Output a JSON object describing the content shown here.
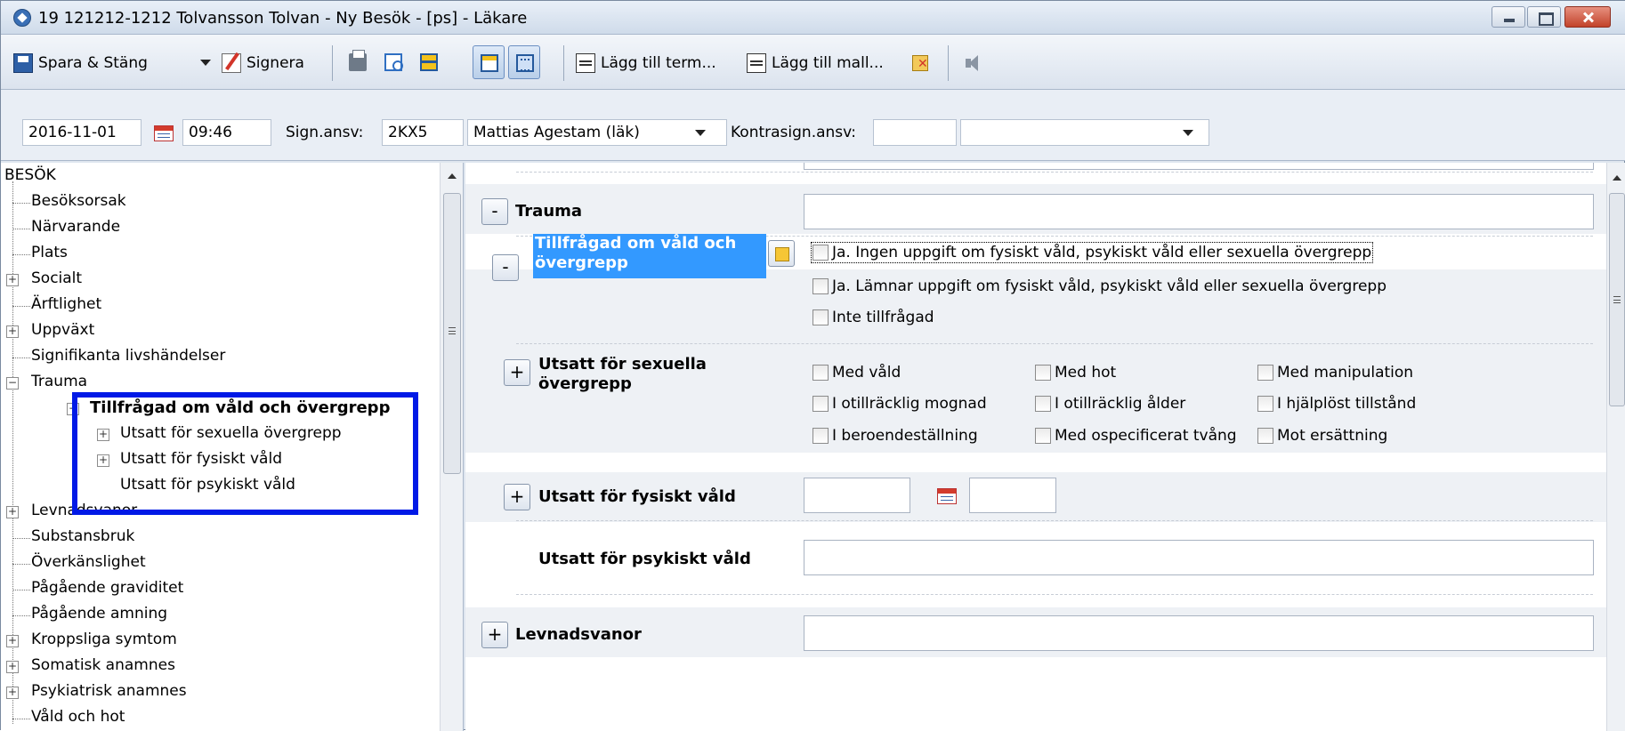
{
  "window": {
    "title": "19 121212-1212 Tolvansson Tolvan - Ny Besök - [ps] - Läkare"
  },
  "toolbar": {
    "save_close": "Spara & Stäng",
    "sign": "Signera",
    "add_term": "Lägg till term...",
    "add_template": "Lägg till mall..."
  },
  "header": {
    "date": "2016-11-01",
    "time": "09:46",
    "sign_resp_label": "Sign.ansv:",
    "sign_resp_code": "2KX5",
    "sign_resp_name": "Mattias Agestam (läk)",
    "countersign_label": "Kontrasign.ansv:",
    "countersign_code": "",
    "countersign_name": ""
  },
  "tree": {
    "root": "BESÖK",
    "items": [
      {
        "label": "Besöksorsak"
      },
      {
        "label": "Närvarande"
      },
      {
        "label": "Plats"
      },
      {
        "label": "Socialt"
      },
      {
        "label": "Ärftlighet"
      },
      {
        "label": "Uppväxt"
      },
      {
        "label": "Signifikanta livshändelser"
      },
      {
        "label": "Trauma"
      },
      {
        "label": "Tillfrågad om våld och övergrepp"
      },
      {
        "label": "Utsatt för sexuella övergrepp"
      },
      {
        "label": "Utsatt för fysiskt våld"
      },
      {
        "label": "Utsatt för psykiskt våld"
      },
      {
        "label": "Levnadsvanor"
      },
      {
        "label": "Substansbruk"
      },
      {
        "label": "Överkänslighet"
      },
      {
        "label": "Pågående graviditet"
      },
      {
        "label": "Pågående amning"
      },
      {
        "label": "Kroppsliga symtom"
      },
      {
        "label": "Somatisk anamnes"
      },
      {
        "label": "Psykiatrisk anamnes"
      },
      {
        "label": "Våld och hot"
      }
    ]
  },
  "form": {
    "trauma": {
      "label": "Trauma",
      "value": ""
    },
    "asked": {
      "label": "Tillfrågad om våld och övergrepp",
      "options": [
        "Ja. Ingen uppgift om fysiskt våld, psykiskt våld eller sexuella övergrepp",
        "Ja. Lämnar uppgift om fysiskt våld, psykiskt våld eller sexuella övergrepp",
        "Inte tillfrågad"
      ]
    },
    "sexual": {
      "label": "Utsatt för sexuella övergrepp",
      "options": [
        "Med våld",
        "Med hot",
        "Med manipulation",
        "I otillräcklig mognad",
        "I otillräcklig ålder",
        "I hjälplöst tillstånd",
        "I beroendeställning",
        "Med ospecificerat tvång",
        "Mot ersättning"
      ]
    },
    "physical": {
      "label": "Utsatt för fysiskt våld",
      "date": "",
      "extra": ""
    },
    "psychological": {
      "label": "Utsatt för psykiskt våld",
      "value": ""
    },
    "lifestyle": {
      "label": "Levnadsvanor",
      "value": ""
    }
  }
}
